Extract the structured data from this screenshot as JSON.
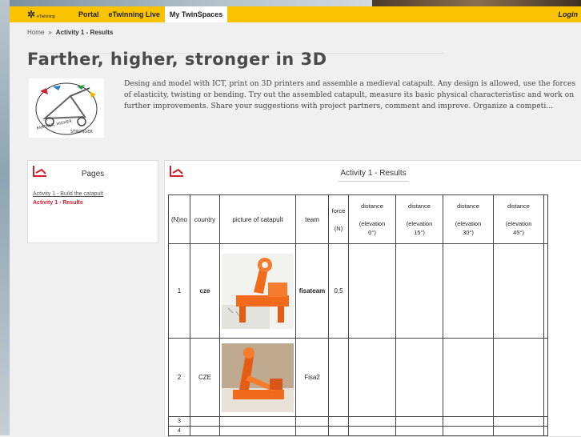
{
  "navbar": {
    "logo_text": "eTwinning",
    "links": [
      "Portal",
      "eTwinning Live",
      "My TwinSpaces"
    ],
    "active_index": 2,
    "login": "Login"
  },
  "breadcrumb": {
    "home": "Home",
    "separator": "»",
    "current": "Activity 1 - Results"
  },
  "project": {
    "title": "Farther, higher, stronger in 3D",
    "description": "Desing and model with ICT, print on 3D printers and assemble a medieval catapult. Any design is allowed, use the forces of elasticity, twisting or bending. Try out the assembled catapult, measure its basic physical characteristisc and work on further improvements. Share your suggestions with project partners, comment and improve. Organize a competi...",
    "logo_lettering": "FARTHER, HIGHER, STRONGER IN 3D"
  },
  "pages_panel": {
    "title": "Pages",
    "links": [
      "Activity 1 - Build the catapult",
      "Activity 1 - Results"
    ],
    "active_index": 1
  },
  "main_panel": {
    "title": "Activity 1 - Results",
    "table": {
      "headers": {
        "no": "(N)no",
        "country": "country",
        "picture": "picture of catapult",
        "team": "team",
        "force_1": "force",
        "force_2": "(N)",
        "d0_1": "distance",
        "d0_2": "(elevation",
        "d0_3": "0°)",
        "d15_1": "distance",
        "d15_2": "(elevation",
        "d15_3": "15°)",
        "d30_1": "distance",
        "d30_2": "(elevation",
        "d30_3": "30°)",
        "d45_1": "distance",
        "d45_2": "(elevation",
        "d45_3": "45°)"
      },
      "rows": [
        {
          "no": "1",
          "country": "cze",
          "team": "fisateam",
          "force": "0,5"
        },
        {
          "no": "2",
          "country": "CZE",
          "team": "Fisa2",
          "force": ""
        },
        {
          "no": "3",
          "country": "",
          "team": "",
          "force": ""
        },
        {
          "no": "4",
          "country": "",
          "team": "",
          "force": ""
        }
      ]
    }
  },
  "colors": {
    "navbar": "#f8c300",
    "accent_red": "#d21f2e",
    "catapult_orange": "#f26a1b"
  }
}
